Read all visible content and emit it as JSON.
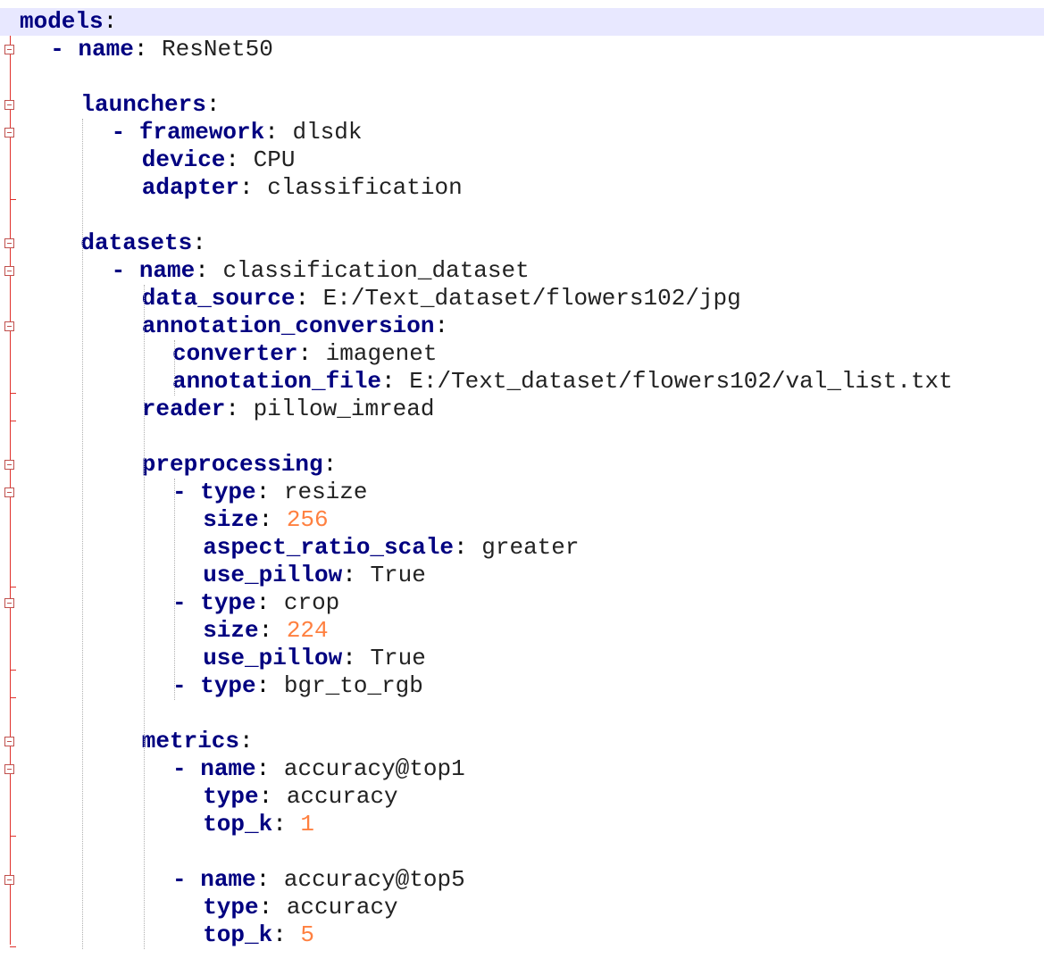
{
  "editor": {
    "lines": [
      {
        "indent": 0,
        "dash": false,
        "key": "models",
        "value": "",
        "value_type": "none",
        "fold": true
      },
      {
        "indent": 1,
        "dash": true,
        "key": "name",
        "value": "ResNet50",
        "value_type": "str",
        "fold": true
      },
      {
        "indent": 0,
        "dash": false,
        "key": "",
        "value": "",
        "value_type": "none",
        "fold": false
      },
      {
        "indent": 2,
        "dash": false,
        "key": "launchers",
        "value": "",
        "value_type": "none",
        "fold": true
      },
      {
        "indent": 3,
        "dash": true,
        "key": "framework",
        "value": "dlsdk",
        "value_type": "str",
        "fold": true
      },
      {
        "indent": 4,
        "dash": false,
        "key": "device",
        "value": "CPU",
        "value_type": "str",
        "fold": false
      },
      {
        "indent": 4,
        "dash": false,
        "key": "adapter",
        "value": "classification",
        "value_type": "str",
        "fold": false
      },
      {
        "indent": 0,
        "dash": false,
        "key": "",
        "value": "",
        "value_type": "none",
        "fold": false
      },
      {
        "indent": 2,
        "dash": false,
        "key": "datasets",
        "value": "",
        "value_type": "none",
        "fold": true
      },
      {
        "indent": 3,
        "dash": true,
        "key": "name",
        "value": "classification_dataset",
        "value_type": "str",
        "fold": true
      },
      {
        "indent": 4,
        "dash": false,
        "key": "data_source",
        "value": "E:/Text_dataset/flowers102/jpg",
        "value_type": "str",
        "fold": false
      },
      {
        "indent": 4,
        "dash": false,
        "key": "annotation_conversion",
        "value": "",
        "value_type": "none",
        "fold": true
      },
      {
        "indent": 5,
        "dash": false,
        "key": "converter",
        "value": "imagenet",
        "value_type": "str",
        "fold": false
      },
      {
        "indent": 5,
        "dash": false,
        "key": "annotation_file",
        "value": "E:/Text_dataset/flowers102/val_list.txt",
        "value_type": "str",
        "fold": false
      },
      {
        "indent": 4,
        "dash": false,
        "key": "reader",
        "value": "pillow_imread",
        "value_type": "str",
        "fold": false
      },
      {
        "indent": 0,
        "dash": false,
        "key": "",
        "value": "",
        "value_type": "none",
        "fold": false
      },
      {
        "indent": 4,
        "dash": false,
        "key": "preprocessing",
        "value": "",
        "value_type": "none",
        "fold": true
      },
      {
        "indent": 5,
        "dash": true,
        "key": "type",
        "value": "resize",
        "value_type": "str",
        "fold": true
      },
      {
        "indent": 6,
        "dash": false,
        "key": "size",
        "value": "256",
        "value_type": "num",
        "fold": false
      },
      {
        "indent": 6,
        "dash": false,
        "key": "aspect_ratio_scale",
        "value": "greater",
        "value_type": "str",
        "fold": false
      },
      {
        "indent": 6,
        "dash": false,
        "key": "use_pillow",
        "value": "True",
        "value_type": "str",
        "fold": false
      },
      {
        "indent": 5,
        "dash": true,
        "key": "type",
        "value": "crop",
        "value_type": "str",
        "fold": true
      },
      {
        "indent": 6,
        "dash": false,
        "key": "size",
        "value": "224",
        "value_type": "num",
        "fold": false
      },
      {
        "indent": 6,
        "dash": false,
        "key": "use_pillow",
        "value": "True",
        "value_type": "str",
        "fold": false
      },
      {
        "indent": 5,
        "dash": true,
        "key": "type",
        "value": "bgr_to_rgb",
        "value_type": "str",
        "fold": false
      },
      {
        "indent": 0,
        "dash": false,
        "key": "",
        "value": "",
        "value_type": "none",
        "fold": false
      },
      {
        "indent": 4,
        "dash": false,
        "key": "metrics",
        "value": "",
        "value_type": "none",
        "fold": true
      },
      {
        "indent": 5,
        "dash": true,
        "key": "name",
        "value": "accuracy@top1",
        "value_type": "str",
        "fold": true
      },
      {
        "indent": 6,
        "dash": false,
        "key": "type",
        "value": "accuracy",
        "value_type": "str",
        "fold": false
      },
      {
        "indent": 6,
        "dash": false,
        "key": "top_k",
        "value": "1",
        "value_type": "num",
        "fold": false
      },
      {
        "indent": 0,
        "dash": false,
        "key": "",
        "value": "",
        "value_type": "none",
        "fold": false
      },
      {
        "indent": 5,
        "dash": true,
        "key": "name",
        "value": "accuracy@top5",
        "value_type": "str",
        "fold": true
      },
      {
        "indent": 6,
        "dash": false,
        "key": "type",
        "value": "accuracy",
        "value_type": "str",
        "fold": false
      },
      {
        "indent": 6,
        "dash": false,
        "key": "top_k",
        "value": "5",
        "value_type": "num",
        "fold": false
      }
    ]
  },
  "colors": {
    "key": "#000080",
    "number": "#ff8040",
    "text": "#222222",
    "current_line": "#e8e8ff",
    "fold_marker": "#e0312b"
  }
}
